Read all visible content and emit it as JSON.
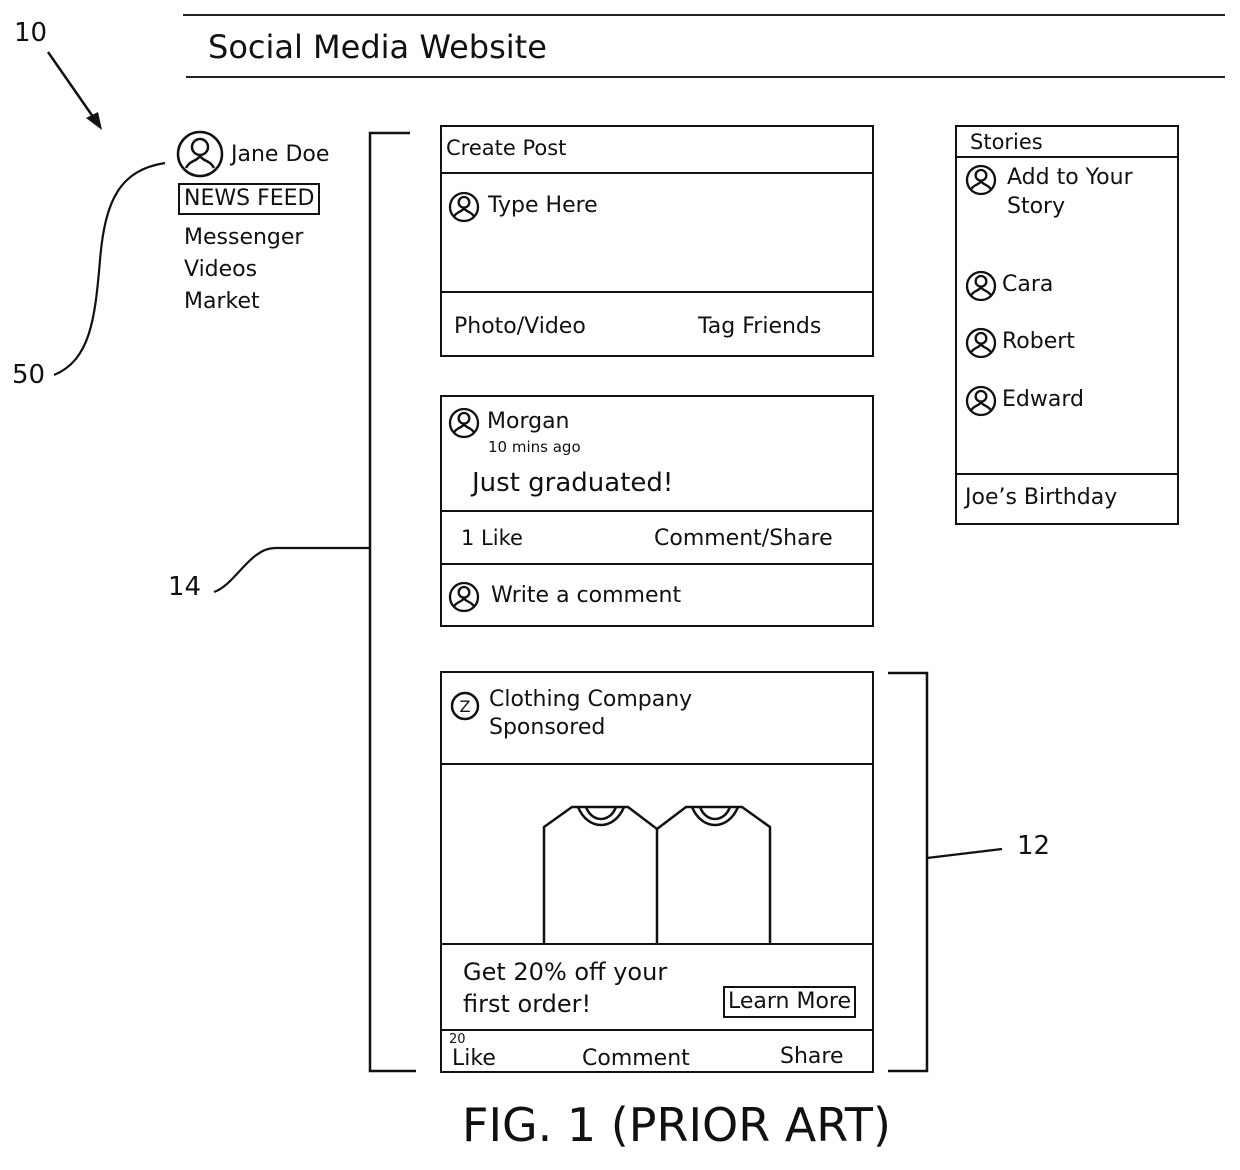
{
  "figure": {
    "label": "FIG. 1 (PRIOR ART)",
    "refs": {
      "website": "10",
      "sidebar": "50",
      "feed": "14",
      "ad": "12"
    }
  },
  "header": {
    "title": "Social Media Website"
  },
  "sidebar": {
    "user_name": "Jane Doe",
    "items": [
      {
        "label": "NEWS FEED",
        "selected": true
      },
      {
        "label": "Messenger",
        "selected": false
      },
      {
        "label": "Videos",
        "selected": false
      },
      {
        "label": "Market",
        "selected": false
      }
    ]
  },
  "create_post": {
    "title": "Create Post",
    "placeholder": "Type Here",
    "actions": [
      "Photo/Video",
      "Tag Friends"
    ]
  },
  "post": {
    "author": "Morgan",
    "time": "10 mins ago",
    "body": "Just graduated!",
    "likes": "1 Like",
    "comment_share": "Comment/Share",
    "comment_placeholder": "Write a comment"
  },
  "ad": {
    "brand_icon_letter": "Z",
    "brand": "Clothing Company",
    "sponsored": "Sponsored",
    "image_alt": "two t-shirts",
    "offer_line1": "Get 20% off your",
    "offer_line2": "first order!",
    "cta": "Learn More",
    "like_count": "20",
    "actions": [
      "Like",
      "Comment",
      "Share"
    ]
  },
  "stories": {
    "title": "Stories",
    "add_story_line1": "Add to Your",
    "add_story_line2": "Story",
    "people": [
      "Cara",
      "Robert",
      "Edward"
    ],
    "footer": "Joe’s Birthday"
  }
}
